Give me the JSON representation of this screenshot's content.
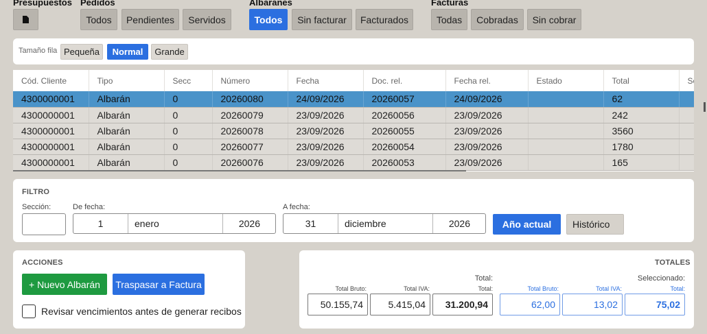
{
  "toolbar": {
    "presupuestos": {
      "title": "Presupuestos"
    },
    "pedidos": {
      "title": "Pedidos",
      "buttons": [
        "Todos",
        "Pendientes",
        "Servidos"
      ]
    },
    "albaranes": {
      "title": "Albaranes",
      "buttons": [
        "Todos",
        "Sin facturar",
        "Facturados"
      ],
      "active": "Todos"
    },
    "facturas": {
      "title": "Facturas",
      "buttons": [
        "Todas",
        "Cobradas",
        "Sin cobrar"
      ]
    }
  },
  "row_size": {
    "label": "Tamaño fila",
    "options": [
      "Pequeña",
      "Normal",
      "Grande"
    ],
    "active": "Normal"
  },
  "table": {
    "columns": [
      "Cód. Cliente",
      "Tipo",
      "Secc",
      "Número",
      "Fecha",
      "Doc. rel.",
      "Fecha rel.",
      "Estado",
      "Total",
      "Se"
    ],
    "rows": [
      [
        "4300000001",
        "Albarán",
        "0",
        "20260080",
        "24/09/2026",
        "20260057",
        "24/09/2026",
        "",
        "62",
        ""
      ],
      [
        "4300000001",
        "Albarán",
        "0",
        "20260079",
        "23/09/2026",
        "20260056",
        "23/09/2026",
        "",
        "242",
        ""
      ],
      [
        "4300000001",
        "Albarán",
        "0",
        "20260078",
        "23/09/2026",
        "20260055",
        "23/09/2026",
        "",
        "3560",
        ""
      ],
      [
        "4300000001",
        "Albarán",
        "0",
        "20260077",
        "23/09/2026",
        "20260054",
        "23/09/2026",
        "",
        "1780",
        ""
      ],
      [
        "4300000001",
        "Albarán",
        "0",
        "20260076",
        "23/09/2026",
        "20260053",
        "23/09/2026",
        "",
        "165",
        ""
      ]
    ],
    "selected_row": 0
  },
  "filter": {
    "title": "FILTRO",
    "seccion_label": "Sección:",
    "seccion_value": "",
    "from_label": "De fecha:",
    "from": {
      "day": "1",
      "month": "enero",
      "year": "2026"
    },
    "to_label": "A fecha:",
    "to": {
      "day": "31",
      "month": "diciembre",
      "year": "2026"
    },
    "current_year_button": "Año actual",
    "history_button": "Histórico"
  },
  "actions": {
    "title": "ACCIONES",
    "new_button": "+ Nuevo Albarán",
    "transfer_button": "Traspasar a Factura",
    "checkbox_label": "Revisar vencimientos antes de generar recibos"
  },
  "totals": {
    "title": "TOTALES",
    "total_head": "Total:",
    "selected_head": "Seleccionado:",
    "bruto_label": "Total Bruto:",
    "iva_label": "Total IVA:",
    "total_label": "Total:",
    "bruto": "50.155,74",
    "iva": "5.415,04",
    "total": "31.200,94",
    "sel_bruto": "62,00",
    "sel_iva": "13,02",
    "sel_total": "75,02"
  },
  "colors": {
    "accent": "#2b6fe0",
    "success": "#1e9a40",
    "selected_row": "#4a93c9"
  }
}
